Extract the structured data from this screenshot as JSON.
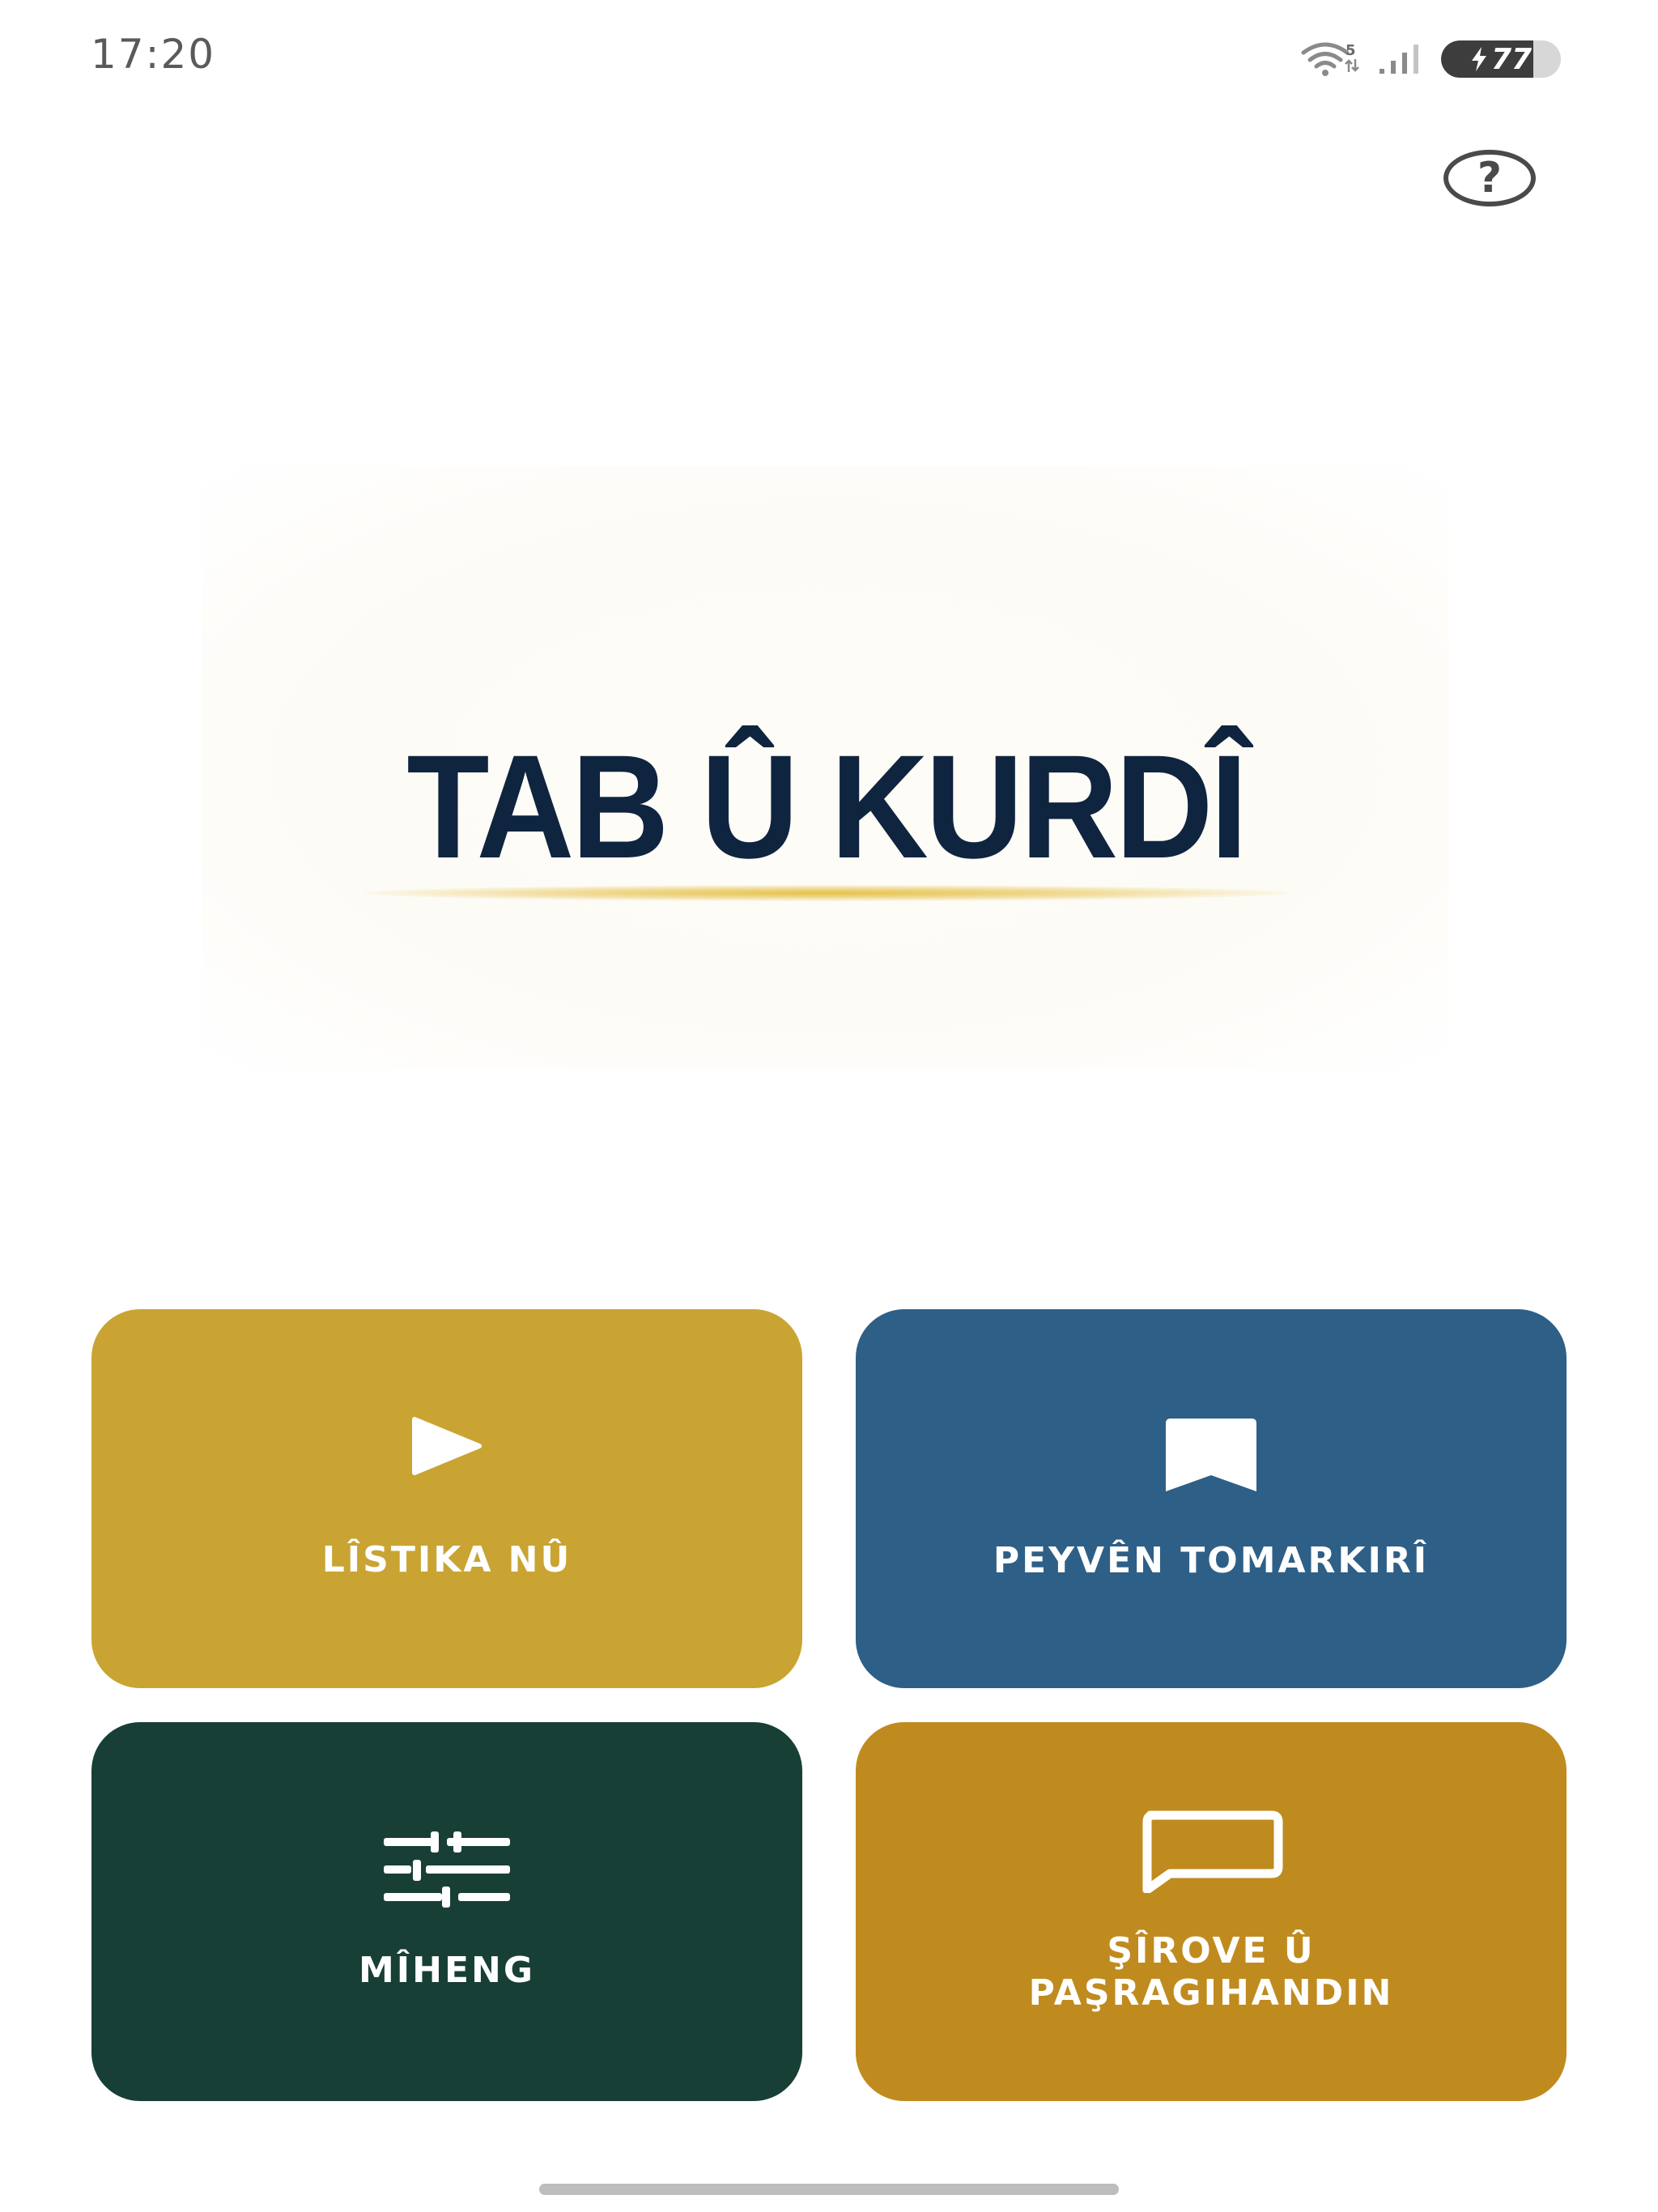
{
  "status_bar": {
    "time": "17:20",
    "wifi_badge": "5",
    "battery_level": "77",
    "battery_percent": 77,
    "battery_charging": true
  },
  "help": {
    "label": "?",
    "icon": "help-circle-icon"
  },
  "logo": {
    "title": "TAB Û KURDÎ",
    "title_color": "#0f243f",
    "underline_color": "#e6c14a"
  },
  "menu": {
    "new_list": {
      "label": "LÎSTIKA NÛ",
      "icon": "play-icon",
      "color": "#c9a433"
    },
    "saved_words": {
      "label": "PEYVÊN TOMARKIRÎ",
      "icon": "bookmark-icon",
      "color": "#2e5f87"
    },
    "settings": {
      "label": "MÎHENG",
      "icon": "sliders-icon",
      "color": "#183f36"
    },
    "feedback": {
      "label_line1": "ŞÎROVE Û",
      "label_line2": "PAŞRAGIHANDIN",
      "icon": "message-square-icon",
      "color": "#c08b1e"
    }
  }
}
